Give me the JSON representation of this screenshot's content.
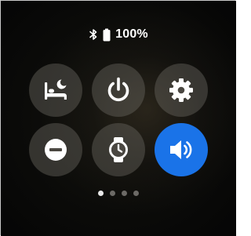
{
  "status": {
    "bluetooth_icon": "bluetooth-icon",
    "battery_icon": "battery-icon",
    "battery_level": "100%"
  },
  "tiles": [
    {
      "icon": "bedtime-mode-icon",
      "active": false
    },
    {
      "icon": "power-icon",
      "active": false
    },
    {
      "icon": "settings-gear-icon",
      "active": false
    },
    {
      "icon": "do-not-disturb-icon",
      "active": false
    },
    {
      "icon": "watch-only-mode-icon",
      "active": false
    },
    {
      "icon": "sound-on-icon",
      "active": true
    }
  ],
  "pager": {
    "total_pages": 4,
    "current_page": 1
  },
  "colors": {
    "active_tile": "#1a73e8",
    "inactive_tile": "#69665f",
    "icon": "#ffffff"
  }
}
